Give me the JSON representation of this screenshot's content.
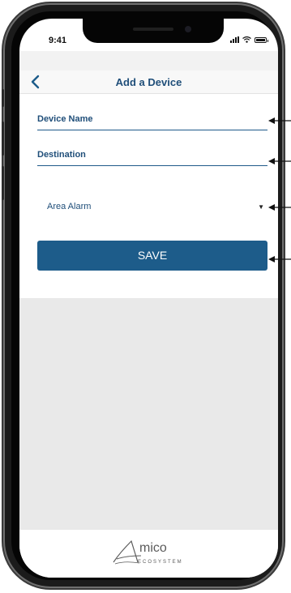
{
  "status_bar": {
    "time": "9:41"
  },
  "nav": {
    "title": "Add a Device"
  },
  "form": {
    "device_name_placeholder": "Device Name",
    "destination_placeholder": "Destination",
    "area_alarm_selected": "Area Alarm",
    "save_label": "SAVE"
  },
  "footer": {
    "logo_text": "mico",
    "logo_sub": "ECOSYSTEM"
  },
  "colors": {
    "accent": "#1d5c8a",
    "text": "#1f4e79",
    "background_gray": "#e9e9e9"
  },
  "icons": {
    "back": "chevron-left-icon",
    "dropdown": "caret-down-icon",
    "signal": "signal-icon",
    "wifi": "wifi-icon",
    "battery": "battery-icon"
  }
}
